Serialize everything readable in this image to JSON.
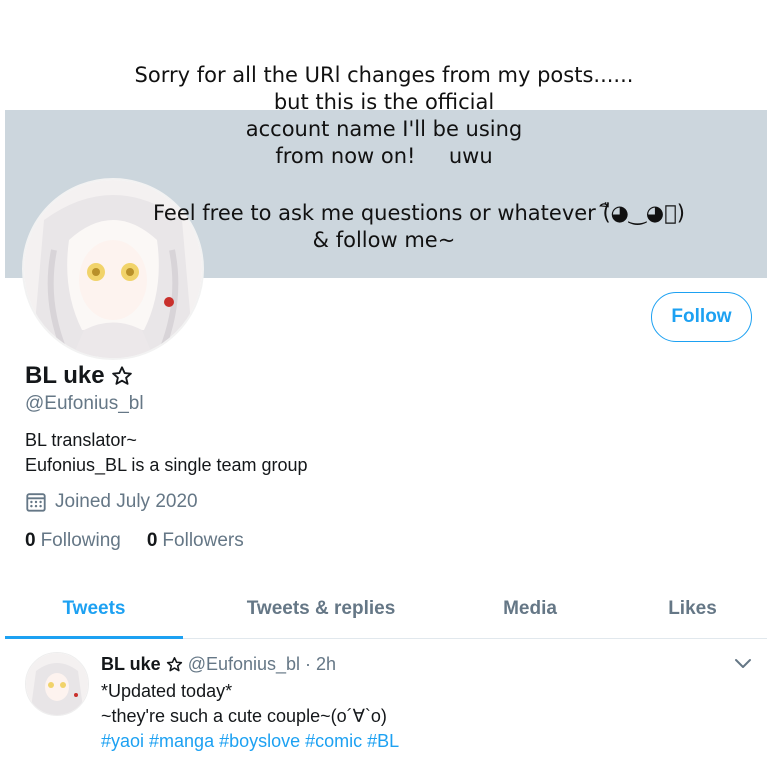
{
  "overlay": {
    "lines": [
      "Sorry for all the URl changes from my posts......",
      "but this is the official",
      "account name I'll be using",
      "from now on!     uwu",
      "Feel free to ask me questions or whatever (ื◕‿◕ื)",
      "& follow me~"
    ]
  },
  "profile": {
    "name": "BL uke",
    "handle": "@Eufonius_bl",
    "bio": [
      "BL translator~",
      "Eufonius_BL is a single team group"
    ],
    "joined": "Joined July 2020",
    "following_count": "0",
    "following_label": "Following",
    "followers_count": "0",
    "followers_label": "Followers",
    "follow_button": "Follow"
  },
  "tabs": [
    "Tweets",
    "Tweets & replies",
    "Media",
    "Likes"
  ],
  "active_tab": "Tweets",
  "tweet": {
    "name": "BL uke",
    "handle_time": "@Eufonius_bl · 2h",
    "line1": "*Updated today*",
    "line2": "~they're such a cute couple~(o´∀`o)",
    "hashtags": "#yaoi #manga #boyslove #comic #BL"
  },
  "colors": {
    "accent": "#1da1f2",
    "banner": "#ccd6dd",
    "secondary_text": "#657786"
  },
  "icons": [
    "star-icon",
    "calendar-icon",
    "chevron-down-icon"
  ]
}
